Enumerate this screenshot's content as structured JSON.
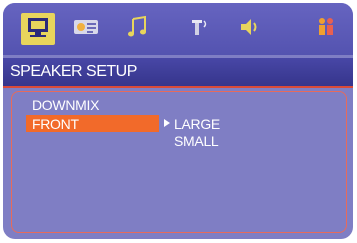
{
  "tabs": [
    {
      "icon": "monitor-icon",
      "selected": true
    },
    {
      "icon": "audio-settings-icon",
      "selected": false
    },
    {
      "icon": "music-note-icon",
      "selected": false
    },
    {
      "icon": "speaker-icon",
      "selected": false
    },
    {
      "icon": "volume-icon",
      "selected": false
    },
    {
      "icon": "people-icon",
      "selected": false
    }
  ],
  "header": {
    "title": "SPEAKER SETUP"
  },
  "menu": {
    "items": [
      {
        "label": "DOWNMIX",
        "selected": false
      },
      {
        "label": "FRONT",
        "selected": true
      }
    ],
    "options": [
      {
        "label": "LARGE",
        "current": true
      },
      {
        "label": "SMALL",
        "current": false
      }
    ]
  },
  "colors": {
    "background": "#7f7ec4",
    "highlight": "#f26a2a",
    "accent": "#d94a3a",
    "tab_selected": "#e8d55c"
  }
}
